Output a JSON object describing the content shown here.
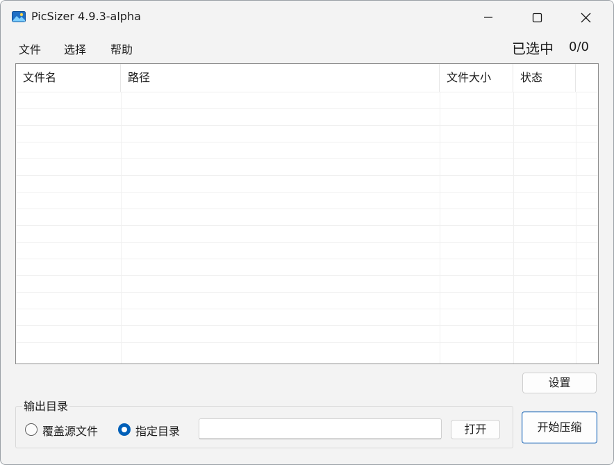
{
  "window": {
    "title": "PicSizer 4.9.3-alpha",
    "app_icon": "landscape-image-icon",
    "controls": {
      "minimize": "minimize-icon",
      "maximize": "maximize-icon",
      "close": "close-icon"
    }
  },
  "menu": {
    "items": [
      {
        "label": "文件"
      },
      {
        "label": "选择"
      },
      {
        "label": "帮助"
      }
    ]
  },
  "selection": {
    "label": "已选中",
    "count": "0/0"
  },
  "table": {
    "columns": [
      {
        "label": "文件名"
      },
      {
        "label": "路径"
      },
      {
        "label": "文件大小"
      },
      {
        "label": "状态"
      }
    ],
    "rows": []
  },
  "buttons": {
    "settings": "设置",
    "open": "打开",
    "start": "开始压缩"
  },
  "output": {
    "group_title": "输出目录",
    "option_overwrite": "覆盖源文件",
    "option_specify": "指定目录",
    "selected_option": "指定目录",
    "dir_value": "",
    "dir_placeholder": ""
  },
  "colors": {
    "accent": "#005fb8",
    "window_bg": "#f3f3f3",
    "table_bg": "#ffffff"
  }
}
